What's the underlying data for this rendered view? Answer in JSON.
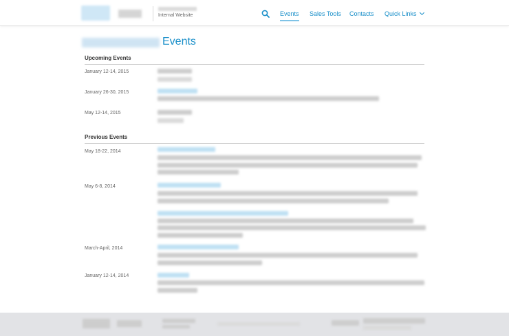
{
  "header": {
    "site_name": "Internal Website",
    "nav": [
      {
        "label": "Events",
        "active": true
      },
      {
        "label": "Sales Tools",
        "active": false
      },
      {
        "label": "Contacts",
        "active": false
      },
      {
        "label": "Quick Links",
        "active": false
      }
    ],
    "search_icon": "search-icon",
    "dropdown_icon": "chevron-down-icon"
  },
  "page": {
    "title": "Events"
  },
  "upcoming": {
    "heading": "Upcoming Events",
    "dates": [
      "January 12-14, 2015",
      "January 26-30, 2015",
      "May 12-14, 2015"
    ]
  },
  "previous": {
    "heading": "Previous Events",
    "dates": [
      "May 18-22, 2014",
      "May 6-8, 2014",
      "March-April, 2014",
      "January 12-14, 2014"
    ]
  },
  "colors": {
    "accent": "#1a8fc9",
    "footer_bg": "#e2e3e6",
    "rule": "#bdbdbd"
  }
}
